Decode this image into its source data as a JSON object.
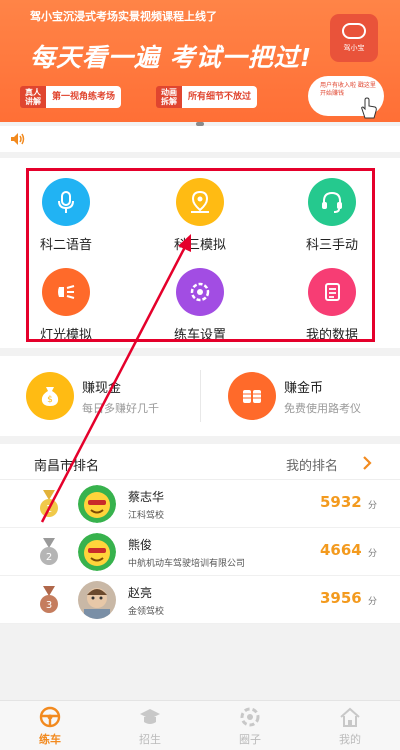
{
  "banner": {
    "top_text": "驾小宝沉浸式考场实景视频课程上线了",
    "headline": "每天看一遍  考试一把过!",
    "logo_label": "驾小宝",
    "tags": [
      {
        "badge": "真人讲解",
        "text": "第一视角练考场"
      },
      {
        "badge": "动画拆解",
        "text": "所有细节不放过"
      }
    ],
    "bubble_text": "用户有收入啦 戳这里 开始赚钱"
  },
  "grid": [
    {
      "label": "科二语音",
      "icon": "microphone-icon",
      "color": "#21b3f3"
    },
    {
      "label": "科三模拟",
      "icon": "location-pin-icon",
      "color": "#ffbb13"
    },
    {
      "label": "科三手动",
      "icon": "headset-icon",
      "color": "#25c98e"
    },
    {
      "label": "灯光模拟",
      "icon": "light-icon",
      "color": "#ff6a2a"
    },
    {
      "label": "练车设置",
      "icon": "settings-icon",
      "color": "#a24de3"
    },
    {
      "label": "我的数据",
      "icon": "data-icon",
      "color": "#f73d74"
    }
  ],
  "earn": [
    {
      "title": "赚现金",
      "subtitle": "每日多赚好几千",
      "icon": "money-bag-icon",
      "color": "#ffbb13"
    },
    {
      "title": "赚金币",
      "subtitle": "免费使用路考仪",
      "icon": "coins-icon",
      "color": "#ff6a2a"
    }
  ],
  "ranking": {
    "title": "南昌市排名",
    "my_rank_label": "我的排名",
    "unit": "分",
    "rows": [
      {
        "rank": "1",
        "name": "蔡志华",
        "school": "江科驾校",
        "score": "5932"
      },
      {
        "rank": "2",
        "name": "熊俊",
        "school": "中航机动车驾驶培训有限公司",
        "score": "4664"
      },
      {
        "rank": "3",
        "name": "赵亮",
        "school": "金领驾校",
        "score": "3956"
      }
    ]
  },
  "nav": [
    {
      "label": "练车",
      "icon": "steering-wheel-icon",
      "active": true
    },
    {
      "label": "招生",
      "icon": "graduation-cap-icon",
      "active": false
    },
    {
      "label": "圈子",
      "icon": "circle-icon",
      "active": false
    },
    {
      "label": "我的",
      "icon": "home-icon",
      "active": false
    }
  ],
  "colors": {
    "accent": "#f28a1f",
    "annotation": "#e5002b"
  }
}
